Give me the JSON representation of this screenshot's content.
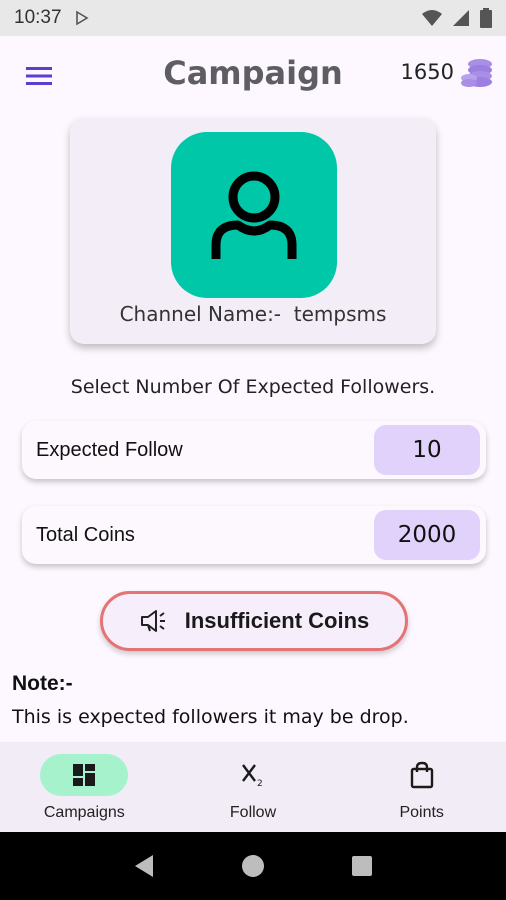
{
  "status_bar": {
    "time": "10:37"
  },
  "header": {
    "title": "Campaign",
    "coins": "1650"
  },
  "profile": {
    "channel_label": "Channel Name:-",
    "channel_name": "tempsms"
  },
  "instructions": "Select Number Of Expected Followers.",
  "fields": [
    {
      "label": "Expected Follow",
      "value": "10"
    },
    {
      "label": "Total Coins",
      "value": "2000"
    }
  ],
  "action": {
    "label": "Insufficient Coins",
    "border_color": "#e57373"
  },
  "note": {
    "title": "Note:-",
    "text": "This is expected followers it may be drop."
  },
  "bottom_nav": {
    "items": [
      {
        "label": "Campaigns",
        "icon": "dashboard-icon",
        "active": true
      },
      {
        "label": "Follow",
        "icon": "x2-icon",
        "active": false
      },
      {
        "label": "Points",
        "icon": "shopping-bag-icon",
        "active": false
      }
    ]
  },
  "colors": {
    "accent": "#5b3fd1",
    "avatar_bg": "#00c7a8",
    "active_pill": "#a6f2cd",
    "value_chip": "#e0d2fb"
  }
}
